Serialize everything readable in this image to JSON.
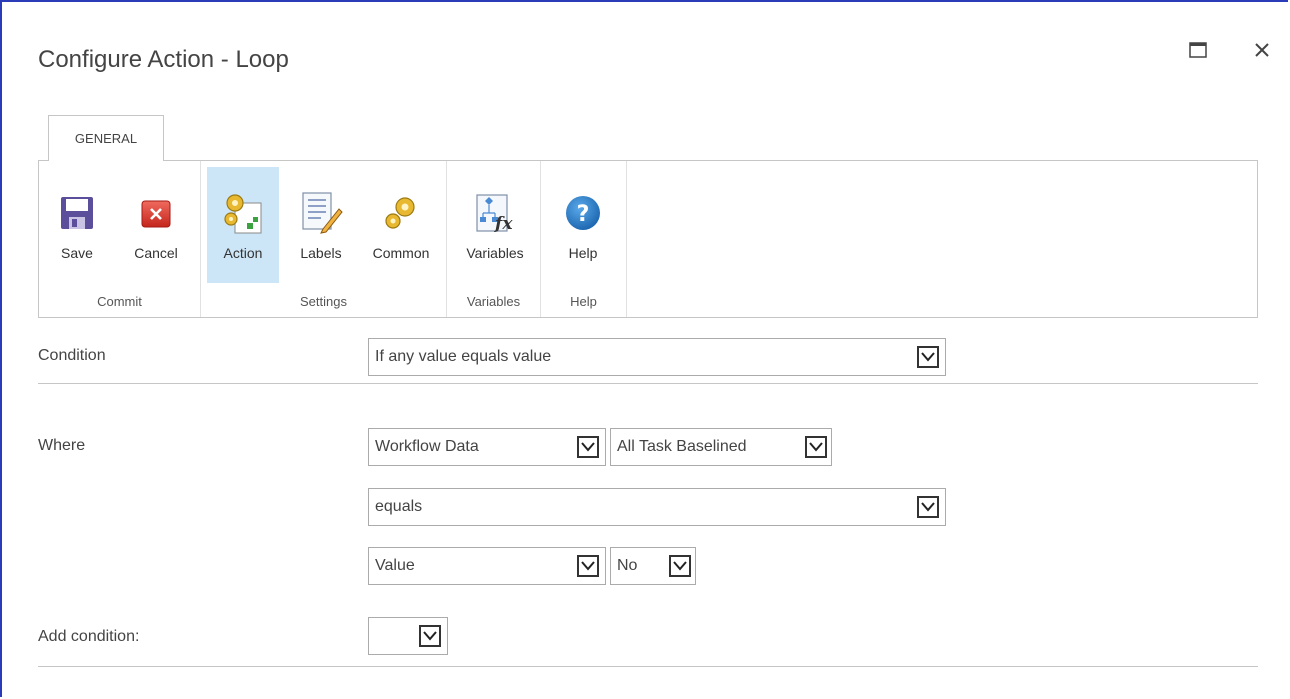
{
  "dialog": {
    "title": "Configure Action - Loop"
  },
  "ribbon": {
    "tab_label": "GENERAL",
    "groups": [
      {
        "label": "Commit",
        "buttons": [
          {
            "label": "Save",
            "icon": "save-icon"
          },
          {
            "label": "Cancel",
            "icon": "cancel-icon"
          }
        ]
      },
      {
        "label": "Settings",
        "buttons": [
          {
            "label": "Action",
            "icon": "action-gears-icon",
            "selected": true
          },
          {
            "label": "Labels",
            "icon": "labels-icon"
          },
          {
            "label": "Common",
            "icon": "common-gears-icon"
          }
        ]
      },
      {
        "label": "Variables",
        "buttons": [
          {
            "label": "Variables",
            "icon": "variables-fx-icon"
          }
        ]
      },
      {
        "label": "Help",
        "buttons": [
          {
            "label": "Help",
            "icon": "help-icon"
          }
        ]
      }
    ]
  },
  "form": {
    "condition": {
      "label": "Condition",
      "value": "If any value equals value"
    },
    "where": {
      "label": "Where",
      "source": "Workflow Data",
      "field": "All Task Baselined",
      "operator": "equals",
      "value_type": "Value",
      "value": "No"
    },
    "add_condition": {
      "label": "Add condition:",
      "value": ""
    }
  },
  "colors": {
    "accent_border": "#2a3cb8",
    "selected_bg": "#cde6f7",
    "help_blue": "#1e7ac7",
    "cancel_red": "#d9342b",
    "save_purple": "#5b4f9c"
  }
}
